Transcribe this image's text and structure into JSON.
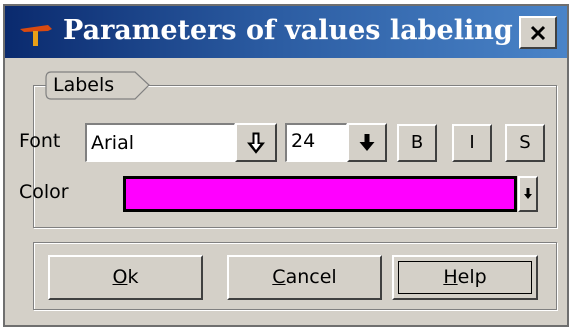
{
  "window": {
    "title": "Parameters of values labeling",
    "close_symbol": "✕"
  },
  "labels_group": {
    "title": "Labels",
    "font_label": "Font",
    "font_value": "Arial",
    "size_value": "24",
    "bold_label": "B",
    "italic_label": "I",
    "strike_label": "S",
    "color_label": "Color",
    "color_value": "#ff00ff"
  },
  "buttons": {
    "ok": {
      "mnemonic": "O",
      "rest": "k"
    },
    "cancel": {
      "mnemonic": "C",
      "rest": "ancel"
    },
    "help": {
      "mnemonic": "H",
      "rest": "elp"
    }
  },
  "icons": {
    "app": "hammer-icon",
    "close": "close-icon",
    "dropdown": "arrow-down-icon"
  },
  "colors": {
    "titlebar_start": "#0a2a6e",
    "titlebar_end": "#4a84c8",
    "dialog_face": "#d4d0c8"
  }
}
